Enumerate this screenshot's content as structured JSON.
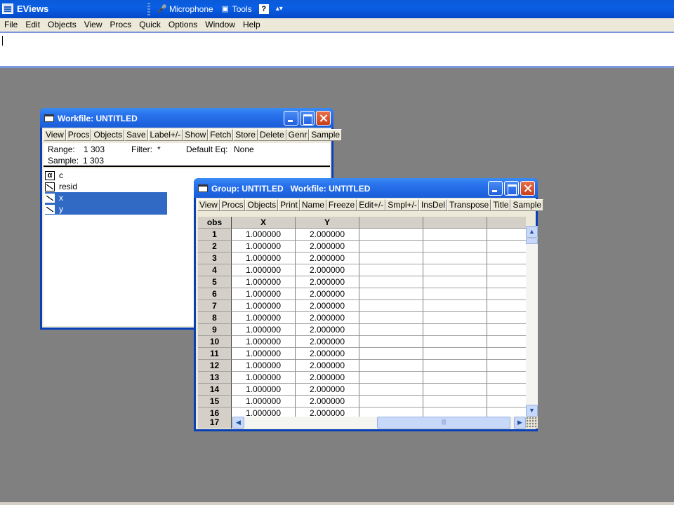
{
  "app": {
    "title": "EViews",
    "langbar": {
      "microphone": "Microphone",
      "tools": "Tools",
      "help": "?",
      "options": "▴▾"
    }
  },
  "menu": [
    "File",
    "Edit",
    "Objects",
    "View",
    "Procs",
    "Quick",
    "Options",
    "Window",
    "Help"
  ],
  "command": {
    "value": ""
  },
  "workfile": {
    "title": "Workfile: UNTITLED",
    "toolbar": [
      "View",
      "Procs",
      "Objects",
      "Save",
      "Label+/-",
      "Show",
      "Fetch",
      "Store",
      "Delete",
      "Genr",
      "Sample"
    ],
    "range_label": "Range:",
    "range_value": "1 303",
    "filter_label": "Filter:",
    "filter_value": "*",
    "default_eq_label": "Default Eq:",
    "default_eq_value": "None",
    "sample_label": "Sample:",
    "sample_value": "1 303",
    "objects": [
      {
        "name": "c",
        "icon": "alpha-icon",
        "selected": false
      },
      {
        "name": "resid",
        "icon": "series-icon",
        "selected": false
      },
      {
        "name": "x",
        "icon": "series-icon",
        "selected": true
      },
      {
        "name": "y",
        "icon": "series-icon",
        "selected": true
      }
    ]
  },
  "group": {
    "title": "Group: UNTITLED   Workfile: UNTITLED",
    "toolbar": [
      "View",
      "Procs",
      "Objects",
      "Print",
      "Name",
      "Freeze",
      "Edit+/-",
      "Smpl+/-",
      "InsDel",
      "Transpose",
      "Title",
      "Sample"
    ],
    "columns": [
      "obs",
      "X",
      "Y",
      "",
      ""
    ],
    "rows": [
      [
        "1",
        "1.000000",
        "2.000000"
      ],
      [
        "2",
        "1.000000",
        "2.000000"
      ],
      [
        "3",
        "1.000000",
        "2.000000"
      ],
      [
        "4",
        "1.000000",
        "2.000000"
      ],
      [
        "5",
        "1.000000",
        "2.000000"
      ],
      [
        "6",
        "1.000000",
        "2.000000"
      ],
      [
        "7",
        "1.000000",
        "2.000000"
      ],
      [
        "8",
        "1.000000",
        "2.000000"
      ],
      [
        "9",
        "1.000000",
        "2.000000"
      ],
      [
        "10",
        "1.000000",
        "2.000000"
      ],
      [
        "11",
        "1.000000",
        "2.000000"
      ],
      [
        "12",
        "1.000000",
        "2.000000"
      ],
      [
        "13",
        "1.000000",
        "2.000000"
      ],
      [
        "14",
        "1.000000",
        "2.000000"
      ],
      [
        "15",
        "1.000000",
        "2.000000"
      ],
      [
        "16",
        "1.000000",
        "2.000000"
      ]
    ],
    "partial_row": "17"
  }
}
